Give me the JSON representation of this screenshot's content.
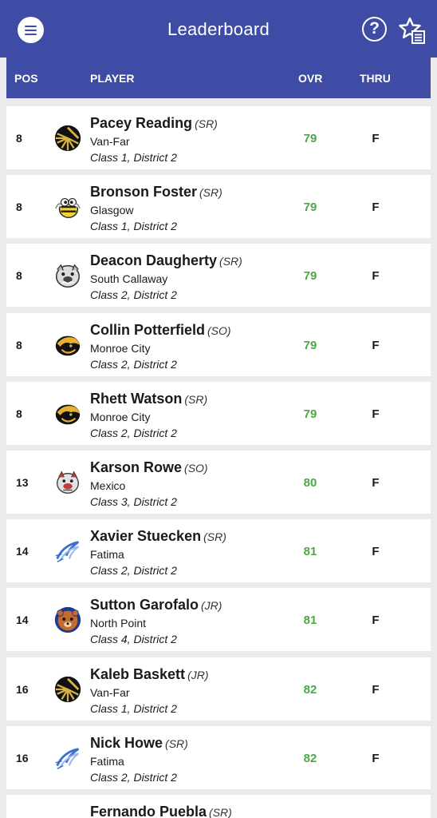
{
  "header": {
    "title": "Leaderboard"
  },
  "table_header": {
    "pos": "POS",
    "player": "PLAYER",
    "ovr": "OVR",
    "thru": "THRU"
  },
  "rows": [
    {
      "pos": "8",
      "name": "Pacey Reading",
      "year": "(SR)",
      "school": "Van-Far",
      "class": "Class 1, District 2",
      "ovr": "79",
      "thru": "F",
      "logo": "van-far-logo"
    },
    {
      "pos": "8",
      "name": "Bronson Foster",
      "year": "(SR)",
      "school": "Glasgow",
      "class": "Class 1, District 2",
      "ovr": "79",
      "thru": "F",
      "logo": "glasgow-logo"
    },
    {
      "pos": "8",
      "name": "Deacon Daugherty",
      "year": "(SR)",
      "school": "South Callaway",
      "class": "Class 2, District 2",
      "ovr": "79",
      "thru": "F",
      "logo": "south-callaway-logo"
    },
    {
      "pos": "8",
      "name": "Collin Potterfield",
      "year": "(SO)",
      "school": "Monroe City",
      "class": "Class 2, District 2",
      "ovr": "79",
      "thru": "F",
      "logo": "monroe-city-logo"
    },
    {
      "pos": "8",
      "name": "Rhett Watson",
      "year": "(SR)",
      "school": "Monroe City",
      "class": "Class 2, District 2",
      "ovr": "79",
      "thru": "F",
      "logo": "monroe-city-logo"
    },
    {
      "pos": "13",
      "name": "Karson Rowe",
      "year": "(SO)",
      "school": "Mexico",
      "class": "Class 3, District 2",
      "ovr": "80",
      "thru": "F",
      "logo": "mexico-logo"
    },
    {
      "pos": "14",
      "name": "Xavier Stuecken",
      "year": "(SR)",
      "school": "Fatima",
      "class": "Class 2, District 2",
      "ovr": "81",
      "thru": "F",
      "logo": "fatima-logo"
    },
    {
      "pos": "14",
      "name": "Sutton Garofalo",
      "year": "(JR)",
      "school": "North Point",
      "class": "Class 4, District 2",
      "ovr": "81",
      "thru": "F",
      "logo": "north-point-logo"
    },
    {
      "pos": "16",
      "name": "Kaleb Baskett",
      "year": "(JR)",
      "school": "Van-Far",
      "class": "Class 1, District 2",
      "ovr": "82",
      "thru": "F",
      "logo": "van-far-logo"
    },
    {
      "pos": "16",
      "name": "Nick Howe",
      "year": "(SR)",
      "school": "Fatima",
      "class": "Class 2, District 2",
      "ovr": "82",
      "thru": "F",
      "logo": "fatima-logo"
    },
    {
      "pos": "",
      "name": "Fernando Puebla",
      "year": "(SR)",
      "school": "",
      "class": "",
      "ovr": "",
      "thru": "",
      "logo": "school-logo"
    }
  ],
  "colors": {
    "brand": "#3f4ca5",
    "ovr": "#4aa845",
    "background": "#ebebee"
  }
}
